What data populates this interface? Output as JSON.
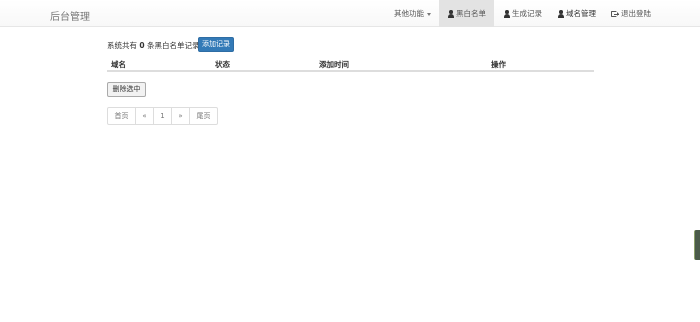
{
  "header": {
    "brand": "后台管理",
    "nav": {
      "other": "其他功能",
      "blacklist": "黑白名单",
      "generate": "生成记录",
      "domain": "域名管理",
      "logout": "退出登陆"
    }
  },
  "main": {
    "summary_prefix": "系统共有",
    "count": "0",
    "summary_suffix": "条黑白名单记录",
    "add_button": "添加记录",
    "table": {
      "headers": [
        "域名",
        "状态",
        "添加时间",
        "操作"
      ]
    },
    "delete_button": "删除选中",
    "pagination": [
      "首页",
      "«",
      "1",
      "»",
      "尾页"
    ]
  }
}
